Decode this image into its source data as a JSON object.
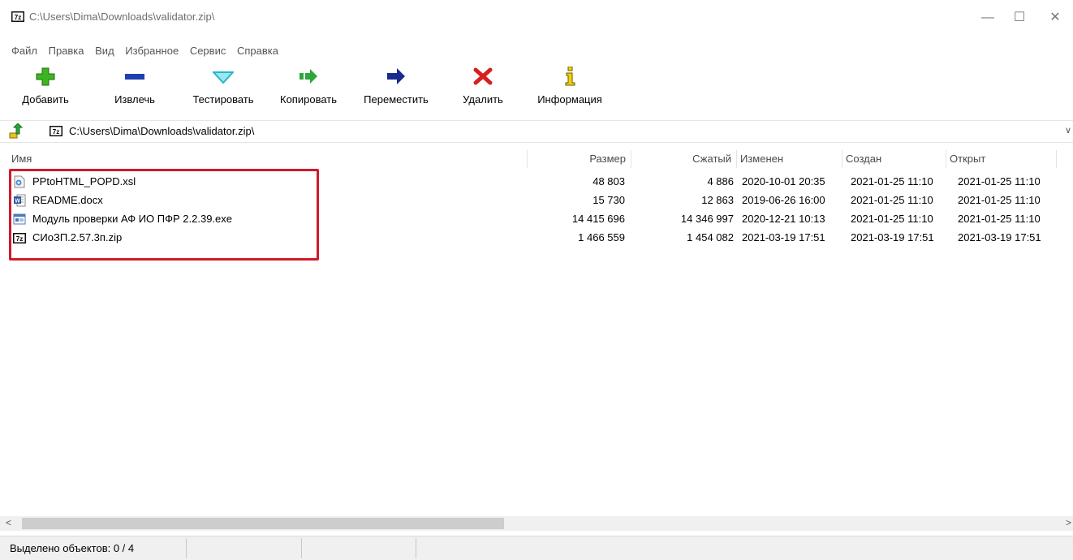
{
  "window": {
    "title": "C:\\Users\\Dima\\Downloads\\validator.zip\\",
    "app_icon": "7z-icon",
    "buttons": {
      "minimize": "—",
      "maximize": "☐",
      "close": "✕"
    }
  },
  "menu": [
    "Файл",
    "Правка",
    "Вид",
    "Избранное",
    "Сервис",
    "Справка"
  ],
  "toolbar": [
    {
      "label": "Добавить",
      "icon": "plus-icon",
      "color": "#3cb521"
    },
    {
      "label": "Извлечь",
      "icon": "minus-icon",
      "color": "#1f3fae"
    },
    {
      "label": "Тестировать",
      "icon": "check-icon",
      "color": "#25b8c8"
    },
    {
      "label": "Копировать",
      "icon": "copy-arrow-icon",
      "color": "#2ea63a"
    },
    {
      "label": "Переместить",
      "icon": "move-arrow-icon",
      "color": "#1a2a8f"
    },
    {
      "label": "Удалить",
      "icon": "delete-x-icon",
      "color": "#d61f1f"
    },
    {
      "label": "Информация",
      "icon": "info-icon",
      "color": "#c8a800"
    }
  ],
  "address": {
    "path": "C:\\Users\\Dima\\Downloads\\validator.zip\\",
    "up_icon": "folder-up-icon",
    "dropdown": "∨"
  },
  "columns": [
    "Имя",
    "Размер",
    "Сжатый",
    "Изменен",
    "Создан",
    "Открыт"
  ],
  "files": [
    {
      "icon": "xsl-file-icon",
      "name": "PPtoHTML_POPD.xsl",
      "size": "48 803",
      "packed": "4 886",
      "modified": "2020-10-01 20:35",
      "created": "2021-01-25 11:10",
      "accessed": "2021-01-25 11:10"
    },
    {
      "icon": "word-doc-icon",
      "name": "README.docx",
      "size": "15 730",
      "packed": "12 863",
      "modified": "2019-06-26 16:00",
      "created": "2021-01-25 11:10",
      "accessed": "2021-01-25 11:10"
    },
    {
      "icon": "exe-file-icon",
      "name": "Модуль проверки АФ ИО ПФР 2.2.39.exe",
      "size": "14 415 696",
      "packed": "14 346 997",
      "modified": "2020-12-21 10:13",
      "created": "2021-01-25 11:10",
      "accessed": "2021-01-25 11:10"
    },
    {
      "icon": "7z-icon",
      "name": "СИоЗП.2.57.3п.zip",
      "size": "1 466 559",
      "packed": "1 454 082",
      "modified": "2021-03-19 17:51",
      "created": "2021-03-19 17:51",
      "accessed": "2021-03-19 17:51"
    }
  ],
  "status": {
    "selected": "Выделено объектов: 0 / 4"
  },
  "colors": {
    "highlight_box": "#d11a2a",
    "status_bg": "#f0f0f0"
  }
}
